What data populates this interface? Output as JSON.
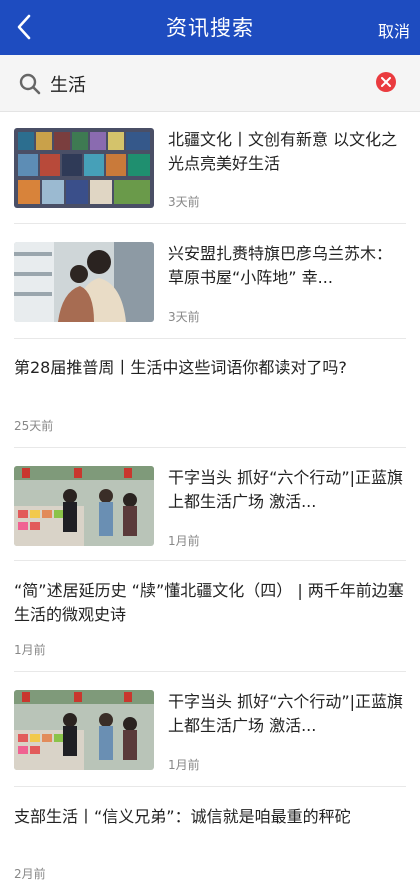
{
  "header": {
    "title": "资讯搜索",
    "cancel_label": "取消",
    "back_icon": "chevron-left-icon"
  },
  "search": {
    "value": "生活",
    "icon": "search-icon",
    "clear_icon": "clear-icon",
    "clear_color": "#ea3b3f"
  },
  "colors": {
    "header_bg": "#1e4cc0",
    "text": "#222222",
    "time": "#888888"
  },
  "news": [
    {
      "title": "北疆文化丨文创有新意  以文化之光点亮美好生活",
      "time": "3天前",
      "has_image": true
    },
    {
      "title": "兴安盟扎赉特旗巴彦乌兰苏木：草原书屋“小阵地”  幸...",
      "time": "3天前",
      "has_image": true
    },
    {
      "title": "第28届推普周丨生活中这些词语你都读对了吗?",
      "time": "25天前",
      "has_image": false
    },
    {
      "title": "干字当头  抓好“六个行动”|正蓝旗上都生活广场  激活...",
      "time": "1月前",
      "has_image": true
    },
    {
      "title": "“简”述居延历史  “牍”懂北疆文化（四）  |  两千年前边塞生活的微观史诗",
      "time": "1月前",
      "has_image": false
    },
    {
      "title": "干字当头  抓好“六个行动”|正蓝旗上都生活广场  激活...",
      "time": "1月前",
      "has_image": true
    },
    {
      "title": "支部生活丨“信义兄弟”：诚信就是咱最重的秤砣",
      "time": "2月前",
      "has_image": false
    }
  ]
}
